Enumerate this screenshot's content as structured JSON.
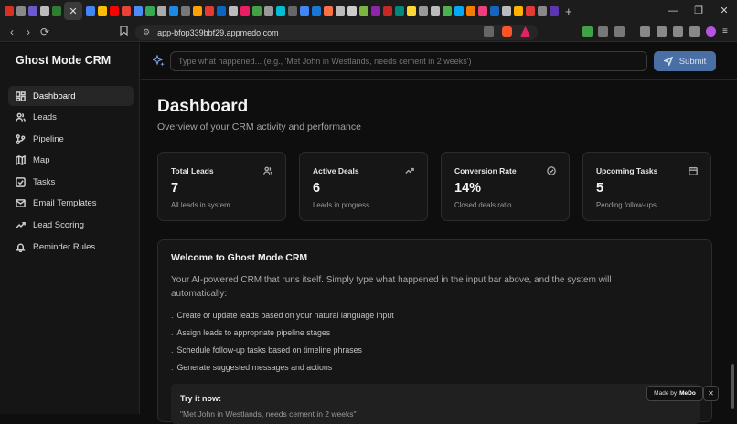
{
  "browser": {
    "url": "app-bfop339bbf29.appmedo.com",
    "tab_close_glyph": "✕",
    "new_tab_glyph": "+",
    "window_controls": [
      "—",
      "❐",
      "✕"
    ],
    "nav_glyphs": [
      "‹",
      "›",
      "⟳"
    ],
    "tab_icon_colors": [
      "#d93025",
      "#888",
      "#6a5acd",
      "#bbb",
      "#2e7d32",
      "#4285f4",
      "#fbbc05",
      "#ff0000",
      "#ea4335",
      "#4c8bf5",
      "#34a853",
      "#aaa",
      "#1e88e5",
      "#777",
      "#ffa000",
      "#e53935",
      "#0a66c2",
      "#bbb",
      "#e91e63",
      "#43a047",
      "#999",
      "#00bcd4",
      "#666",
      "#4285f4",
      "#1976d2",
      "#ff7043",
      "#bbb",
      "#ccc",
      "#7cb342",
      "#8e24aa",
      "#c62828",
      "#00897b",
      "#fdd835",
      "#999",
      "#bbb",
      "#4caf50",
      "#03a9f4",
      "#f57c00",
      "#ec407a",
      "#1565c0",
      "#bbb",
      "#ffb300",
      "#e53935",
      "#888",
      "#5e35b1"
    ]
  },
  "app": {
    "brand": "Ghost Mode CRM",
    "menu": [
      {
        "label": "Dashboard",
        "icon": "dashboard-icon",
        "active": true
      },
      {
        "label": "Leads",
        "icon": "users-icon"
      },
      {
        "label": "Pipeline",
        "icon": "pipeline-icon"
      },
      {
        "label": "Map",
        "icon": "map-icon"
      },
      {
        "label": "Tasks",
        "icon": "checkbox-icon"
      },
      {
        "label": "Email Templates",
        "icon": "mail-icon"
      },
      {
        "label": "Lead Scoring",
        "icon": "trending-icon"
      },
      {
        "label": "Reminder Rules",
        "icon": "bell-icon"
      }
    ]
  },
  "command": {
    "placeholder": "Type what happened... (e.g., 'Met John in Westlands, needs cement in 2 weeks')",
    "submit_label": "Submit"
  },
  "dashboard": {
    "title": "Dashboard",
    "subtitle": "Overview of your CRM activity and performance",
    "cards": [
      {
        "title": "Total Leads",
        "value": "7",
        "sub": "All leads in system",
        "icon": "users-icon"
      },
      {
        "title": "Active Deals",
        "value": "6",
        "sub": "Leads in progress",
        "icon": "trending-up-icon"
      },
      {
        "title": "Conversion Rate",
        "value": "14%",
        "sub": "Closed deals ratio",
        "icon": "check-circle-icon"
      },
      {
        "title": "Upcoming Tasks",
        "value": "5",
        "sub": "Pending follow-ups",
        "icon": "calendar-icon"
      }
    ],
    "welcome": {
      "title": "Welcome to Ghost Mode CRM",
      "text": "Your AI-powered CRM that runs itself. Simply type what happened in the input bar above, and the system will automatically:",
      "bullets": [
        "Create or update leads based on your natural language input",
        "Assign leads to appropriate pipeline stages",
        "Schedule follow-up tasks based on timeline phrases",
        "Generate suggested messages and actions"
      ],
      "try_title": "Try it now:",
      "try_text": "\"Met John in Westlands, needs cement in 2 weeks\""
    }
  },
  "badge": {
    "prefix": "Made by",
    "brand": "MeDo",
    "close": "✕"
  },
  "colors": {
    "accent": "#4a6fa5",
    "background": "#0e0e0e",
    "card": "#161616"
  }
}
